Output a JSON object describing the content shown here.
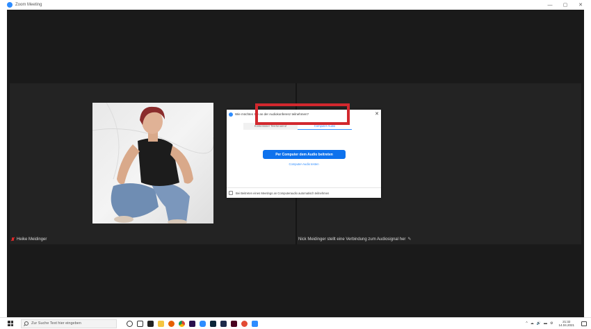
{
  "window": {
    "title": "Zoom Meeting",
    "controls": {
      "minimize": "—",
      "maximize": "▢",
      "close": "✕"
    }
  },
  "participants": [
    {
      "name": "Heike Meidinger",
      "mic": "muted"
    },
    {
      "name": "Nick Meidinger stellt eine Verbindung zum Audiosignal her",
      "status_icon": "pencil-icon"
    }
  ],
  "audio_dialog": {
    "title": "Wie möchten Sie an der Audiokonferenz teilnehmen?",
    "close_label": "✕",
    "tabs": [
      {
        "label": "Kostenloser Telefonanruf",
        "active": false
      },
      {
        "label": "Computer-Audio",
        "active": true
      }
    ],
    "join_button_label": "Per Computer dem Audio beitreten",
    "test_link_label": "Computer-Audio testen",
    "auto_join_checkbox_label": "Bei Beitreten eines Meetings an Computeraudio automatisch teilnehmen"
  },
  "taskbar": {
    "search_placeholder": "Zur Suche Text hier eingeben",
    "tray_icons": [
      "^",
      "☁",
      "🔊",
      "▬",
      "⚙"
    ],
    "time": "21:32",
    "date": "14.04.2021"
  },
  "colors": {
    "zoom_blue": "#2d8cff",
    "join_button": "#0e72ed",
    "highlight": "#d2282e",
    "meeting_bg": "#1a1a1a",
    "muted_mic": "#e02828"
  }
}
